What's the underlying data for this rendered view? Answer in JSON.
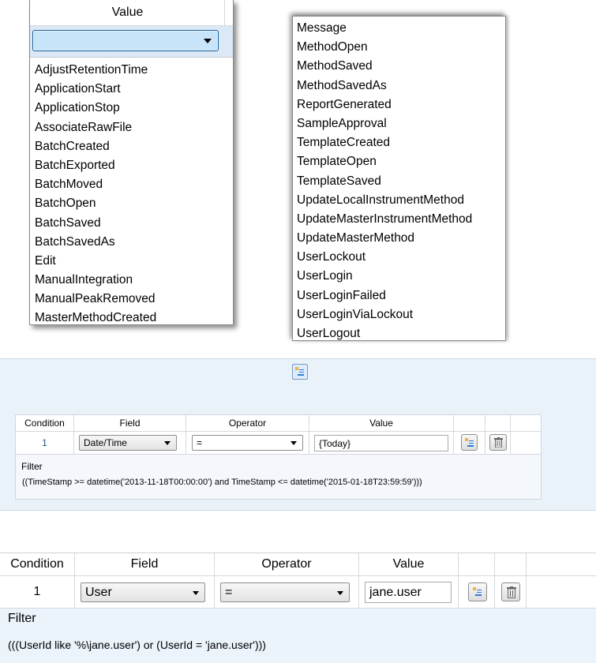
{
  "events_dropdown": {
    "header": "Value",
    "selected_value": "",
    "items": [
      "AdjustRetentionTime",
      "ApplicationStart",
      "ApplicationStop",
      "AssociateRawFile",
      "BatchCreated",
      "BatchExported",
      "BatchMoved",
      "BatchOpen",
      "BatchSaved",
      "BatchSavedAs",
      "Edit",
      "ManualIntegration",
      "ManualPeakRemoved",
      "MasterMethodCreated"
    ]
  },
  "events_list_continued": {
    "items": [
      "Message",
      "MethodOpen",
      "MethodSaved",
      "MethodSavedAs",
      "ReportGenerated",
      "SampleApproval",
      "TemplateCreated",
      "TemplateOpen",
      "TemplateSaved",
      "UpdateLocalInstrumentMethod",
      "UpdateMasterInstrumentMethod",
      "UpdateMasterMethod",
      "UserLockout",
      "UserLogin",
      "UserLoginFailed",
      "UserLoginViaLockout",
      "UserLogout"
    ]
  },
  "date_filter": {
    "headers": {
      "condition": "Condition",
      "field": "Field",
      "operator": "Operator",
      "value": "Value"
    },
    "row": {
      "condition": "1",
      "field": "Date/Time",
      "operator": "=",
      "value": "{Today}"
    },
    "filter_label": "Filter",
    "filter_expression": "((TimeStamp >= datetime('2013-11-18T00:00:00') and TimeStamp  <= datetime('2015-01-18T23:59:59')))"
  },
  "user_filter": {
    "headers": {
      "condition": "Condition",
      "field": "Field",
      "operator": "Operator",
      "value": "Value"
    },
    "row": {
      "condition": "1",
      "field": "User",
      "operator": "=",
      "value": "jane.user"
    },
    "filter_label": "Filter",
    "filter_expression": "(((UserId like '%\\jane.user') or (UserId = 'jane.user')))"
  },
  "icons": {
    "add_condition": "add-condition-icon",
    "delete_condition": "trash-icon"
  },
  "colors": {
    "panel_bg": "#eaf2f9",
    "selection_blue": "#c7e4f8",
    "condition_number": "#1f4e8c"
  }
}
